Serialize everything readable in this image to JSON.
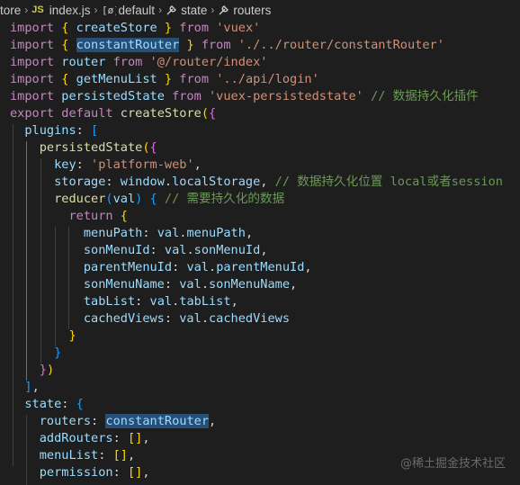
{
  "breadcrumb": {
    "folder": "tore",
    "file_badge": "JS",
    "file": "index.js",
    "symbols": [
      "default",
      "state",
      "routers"
    ]
  },
  "code": {
    "lines": [
      [
        [
          "kw",
          "import"
        ],
        [
          "pl",
          " "
        ],
        [
          "p1",
          "{"
        ],
        [
          "pl",
          " "
        ],
        [
          "var",
          "createStore"
        ],
        [
          "pl",
          " "
        ],
        [
          "p1",
          "}"
        ],
        [
          "pl",
          " "
        ],
        [
          "kw",
          "from"
        ],
        [
          "pl",
          " "
        ],
        [
          "str",
          "'vuex'"
        ]
      ],
      [
        [
          "kw",
          "import"
        ],
        [
          "pl",
          " "
        ],
        [
          "p1",
          "{"
        ],
        [
          "pl",
          " "
        ],
        [
          "var hl",
          "constantRouter"
        ],
        [
          "pl",
          " "
        ],
        [
          "p1",
          "}"
        ],
        [
          "pl",
          " "
        ],
        [
          "kw",
          "from"
        ],
        [
          "pl",
          " "
        ],
        [
          "str",
          "'./../router/constantRouter'"
        ]
      ],
      [
        [
          "kw",
          "import"
        ],
        [
          "pl",
          " "
        ],
        [
          "var",
          "router"
        ],
        [
          "pl",
          " "
        ],
        [
          "kw",
          "from"
        ],
        [
          "pl",
          " "
        ],
        [
          "str",
          "'@/router/index'"
        ]
      ],
      [
        [
          "kw",
          "import"
        ],
        [
          "pl",
          " "
        ],
        [
          "p1",
          "{"
        ],
        [
          "pl",
          " "
        ],
        [
          "var",
          "getMenuList"
        ],
        [
          "pl",
          " "
        ],
        [
          "p1",
          "}"
        ],
        [
          "pl",
          " "
        ],
        [
          "kw",
          "from"
        ],
        [
          "pl",
          " "
        ],
        [
          "str",
          "'../api/login'"
        ]
      ],
      [
        [
          "kw",
          "import"
        ],
        [
          "pl",
          " "
        ],
        [
          "var",
          "persistedState"
        ],
        [
          "pl",
          " "
        ],
        [
          "kw",
          "from"
        ],
        [
          "pl",
          " "
        ],
        [
          "str",
          "'vuex-persistedstate'"
        ],
        [
          "pl",
          " "
        ],
        [
          "cmt",
          "// 数据持久化插件"
        ]
      ],
      [
        [
          "kw",
          "export"
        ],
        [
          "pl",
          " "
        ],
        [
          "kw",
          "default"
        ],
        [
          "pl",
          " "
        ],
        [
          "fn",
          "createStore"
        ],
        [
          "p1",
          "("
        ],
        [
          "p2",
          "{"
        ]
      ],
      [
        [
          "pl",
          "  "
        ],
        [
          "var",
          "plugins"
        ],
        [
          "pl",
          ": "
        ],
        [
          "p3",
          "["
        ]
      ],
      [
        [
          "pl",
          "    "
        ],
        [
          "fn",
          "persistedState"
        ],
        [
          "p1",
          "("
        ],
        [
          "p2",
          "{"
        ]
      ],
      [
        [
          "pl",
          "      "
        ],
        [
          "var",
          "key"
        ],
        [
          "pl",
          ": "
        ],
        [
          "str",
          "'platform-web'"
        ],
        [
          "pl",
          ","
        ]
      ],
      [
        [
          "pl",
          "      "
        ],
        [
          "var",
          "storage"
        ],
        [
          "pl",
          ": "
        ],
        [
          "var",
          "window"
        ],
        [
          "pl",
          "."
        ],
        [
          "var",
          "localStorage"
        ],
        [
          "pl",
          ", "
        ],
        [
          "cmt",
          "// 数据持久化位置 local或者session"
        ]
      ],
      [
        [
          "pl",
          "      "
        ],
        [
          "fn",
          "reducer"
        ],
        [
          "p3",
          "("
        ],
        [
          "var",
          "val"
        ],
        [
          "p3",
          ")"
        ],
        [
          "pl",
          " "
        ],
        [
          "p3",
          "{"
        ],
        [
          "pl",
          " "
        ],
        [
          "cmt",
          "// 需要持久化的数据"
        ]
      ],
      [
        [
          "pl",
          "        "
        ],
        [
          "kw",
          "return"
        ],
        [
          "pl",
          " "
        ],
        [
          "p1",
          "{"
        ]
      ],
      [
        [
          "pl",
          "          "
        ],
        [
          "var",
          "menuPath"
        ],
        [
          "pl",
          ": "
        ],
        [
          "var",
          "val"
        ],
        [
          "pl",
          "."
        ],
        [
          "var",
          "menuPath"
        ],
        [
          "pl",
          ","
        ]
      ],
      [
        [
          "pl",
          "          "
        ],
        [
          "var",
          "sonMenuId"
        ],
        [
          "pl",
          ": "
        ],
        [
          "var",
          "val"
        ],
        [
          "pl",
          "."
        ],
        [
          "var",
          "sonMenuId"
        ],
        [
          "pl",
          ","
        ]
      ],
      [
        [
          "pl",
          "          "
        ],
        [
          "var",
          "parentMenuId"
        ],
        [
          "pl",
          ": "
        ],
        [
          "var",
          "val"
        ],
        [
          "pl",
          "."
        ],
        [
          "var",
          "parentMenuId"
        ],
        [
          "pl",
          ","
        ]
      ],
      [
        [
          "pl",
          "          "
        ],
        [
          "var",
          "sonMenuName"
        ],
        [
          "pl",
          ": "
        ],
        [
          "var",
          "val"
        ],
        [
          "pl",
          "."
        ],
        [
          "var",
          "sonMenuName"
        ],
        [
          "pl",
          ","
        ]
      ],
      [
        [
          "pl",
          "          "
        ],
        [
          "var",
          "tabList"
        ],
        [
          "pl",
          ": "
        ],
        [
          "var",
          "val"
        ],
        [
          "pl",
          "."
        ],
        [
          "var",
          "tabList"
        ],
        [
          "pl",
          ","
        ]
      ],
      [
        [
          "pl",
          "          "
        ],
        [
          "var",
          "cachedViews"
        ],
        [
          "pl",
          ": "
        ],
        [
          "var",
          "val"
        ],
        [
          "pl",
          "."
        ],
        [
          "var",
          "cachedViews"
        ]
      ],
      [
        [
          "pl",
          "        "
        ],
        [
          "p1",
          "}"
        ]
      ],
      [
        [
          "pl",
          "      "
        ],
        [
          "p3",
          "}"
        ]
      ],
      [
        [
          "pl",
          "    "
        ],
        [
          "p2",
          "}"
        ],
        [
          "p1",
          ")"
        ]
      ],
      [
        [
          "pl",
          "  "
        ],
        [
          "p3",
          "]"
        ],
        [
          "pl",
          ","
        ]
      ],
      [
        [
          "pl",
          "  "
        ],
        [
          "var",
          "state"
        ],
        [
          "pl",
          ": "
        ],
        [
          "p3",
          "{"
        ]
      ],
      [
        [
          "pl",
          "    "
        ],
        [
          "var",
          "routers"
        ],
        [
          "pl",
          ": "
        ],
        [
          "var hl",
          "constantRouter"
        ],
        [
          "pl",
          ","
        ]
      ],
      [
        [
          "pl",
          "    "
        ],
        [
          "var",
          "addRouters"
        ],
        [
          "pl",
          ": "
        ],
        [
          "p1",
          "[]"
        ],
        [
          "pl",
          ","
        ]
      ],
      [
        [
          "pl",
          "    "
        ],
        [
          "var",
          "menuList"
        ],
        [
          "pl",
          ": "
        ],
        [
          "p1",
          "[]"
        ],
        [
          "pl",
          ","
        ]
      ],
      [
        [
          "pl",
          "    "
        ],
        [
          "var",
          "permission"
        ],
        [
          "pl",
          ": "
        ],
        [
          "p1",
          "[]"
        ],
        [
          "pl",
          ","
        ]
      ]
    ]
  },
  "watermark": "@稀土掘金技术社区",
  "colors": {
    "background": "#1e1e1e",
    "keyword": "#c586c0",
    "variable": "#9cdcfe",
    "function": "#dcdcaa",
    "string": "#ce9178",
    "comment": "#6a9955",
    "selection_highlight": "#264f78"
  }
}
